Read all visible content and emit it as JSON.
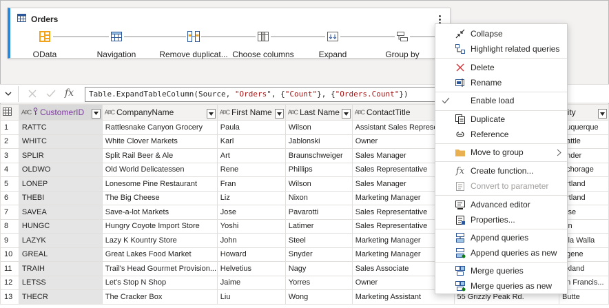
{
  "query": {
    "title": "Orders",
    "steps": [
      {
        "label": "OData",
        "icon": "odata-icon"
      },
      {
        "label": "Navigation",
        "icon": "table-icon"
      },
      {
        "label": "Remove duplicat...",
        "icon": "remove-duplicates-icon"
      },
      {
        "label": "Choose columns",
        "icon": "choose-columns-icon"
      },
      {
        "label": "Expand",
        "icon": "expand-icon"
      },
      {
        "label": "Group by",
        "icon": "group-by-icon"
      }
    ]
  },
  "formula": {
    "fx": "fx",
    "prefix": "Table.ExpandTableColumn(Source, ",
    "s1": "\"Orders\"",
    "mid1": ", {",
    "s2": "\"Count\"",
    "mid2": "}, {",
    "s3": "\"Orders.Count\"",
    "suffix": "})"
  },
  "table": {
    "columns": [
      "CustomerID",
      "CompanyName",
      "First Name",
      "Last Name",
      "ContactTitle",
      "",
      "City"
    ],
    "rows": [
      [
        "1",
        "RATTC",
        "Rattlesnake Canyon Grocery",
        "Paula",
        "Wilson",
        "Assistant Sales Represer",
        "",
        "buquerque"
      ],
      [
        "2",
        "WHITC",
        "White Clover Markets",
        "Karl",
        "Jablonski",
        "Owner",
        "",
        "eattle"
      ],
      [
        "3",
        "SPLIR",
        "Split Rail Beer & Ale",
        "Art",
        "Braunschweiger",
        "Sales Manager",
        "",
        "ander"
      ],
      [
        "4",
        "OLDWO",
        "Old World Delicatessen",
        "Rene",
        "Phillips",
        "Sales Representative",
        "",
        "nchorage"
      ],
      [
        "5",
        "LONEP",
        "Lonesome Pine Restaurant",
        "Fran",
        "Wilson",
        "Sales Manager",
        "",
        "ortland"
      ],
      [
        "6",
        "THEBI",
        "The Big Cheese",
        "Liz",
        "Nixon",
        "Marketing Manager",
        "",
        "ortland"
      ],
      [
        "7",
        "SAVEA",
        "Save-a-lot Markets",
        "Jose",
        "Pavarotti",
        "Sales Representative",
        "",
        "oise"
      ],
      [
        "8",
        "HUNGC",
        "Hungry Coyote Import Store",
        "Yoshi",
        "Latimer",
        "Sales Representative",
        "",
        "gin"
      ],
      [
        "9",
        "LAZYK",
        "Lazy K Kountry Store",
        "John",
        "Steel",
        "Marketing Manager",
        "",
        "alla Walla"
      ],
      [
        "10",
        "GREAL",
        "Great Lakes Food Market",
        "Howard",
        "Snyder",
        "Marketing Manager",
        "",
        "ugene"
      ],
      [
        "11",
        "TRAIH",
        "Trail's Head Gourmet Provision...",
        "Helvetius",
        "Nagy",
        "Sales Associate",
        "",
        "irkland"
      ],
      [
        "12",
        "LETSS",
        "Let's Stop N Shop",
        "Jaime",
        "Yorres",
        "Owner",
        "",
        "an Francis..."
      ],
      [
        "13",
        "THECR",
        "The Cracker Box",
        "Liu",
        "Wong",
        "Marketing Assistant",
        "55 Grizzly Peak Rd.",
        "Butte"
      ]
    ]
  },
  "menu": {
    "items": [
      {
        "label": "Collapse",
        "icon": "collapse-icon",
        "enabled": true
      },
      {
        "label": "Highlight related queries",
        "icon": "highlight-related-icon",
        "enabled": true
      },
      {
        "label": "Delete",
        "icon": "delete-icon",
        "enabled": true
      },
      {
        "label": "Rename",
        "icon": "rename-icon",
        "enabled": true
      },
      {
        "label": "Enable load",
        "icon": "checkmark-icon",
        "enabled": true,
        "checked": true
      },
      {
        "label": "Duplicate",
        "icon": "duplicate-icon",
        "enabled": true
      },
      {
        "label": "Reference",
        "icon": "reference-icon",
        "enabled": true
      },
      {
        "label": "Move to group",
        "icon": "folder-icon",
        "enabled": true,
        "submenu": true
      },
      {
        "label": "Create function...",
        "icon": "function-icon",
        "enabled": true
      },
      {
        "label": "Convert to parameter",
        "icon": "parameter-icon",
        "enabled": false
      },
      {
        "label": "Advanced editor",
        "icon": "advanced-editor-icon",
        "enabled": true
      },
      {
        "label": "Properties...",
        "icon": "properties-icon",
        "enabled": true
      },
      {
        "label": "Append queries",
        "icon": "append-icon",
        "enabled": true
      },
      {
        "label": "Append queries as new",
        "icon": "append-new-icon",
        "enabled": true
      },
      {
        "label": "Merge queries",
        "icon": "merge-icon",
        "enabled": true
      },
      {
        "label": "Merge queries as new",
        "icon": "merge-new-icon",
        "enabled": true
      }
    ]
  },
  "colors": {
    "accent": "#2b88d8",
    "odata": "#f2a21b",
    "selected_column": "#e5e5e5",
    "string": "#a31515"
  }
}
